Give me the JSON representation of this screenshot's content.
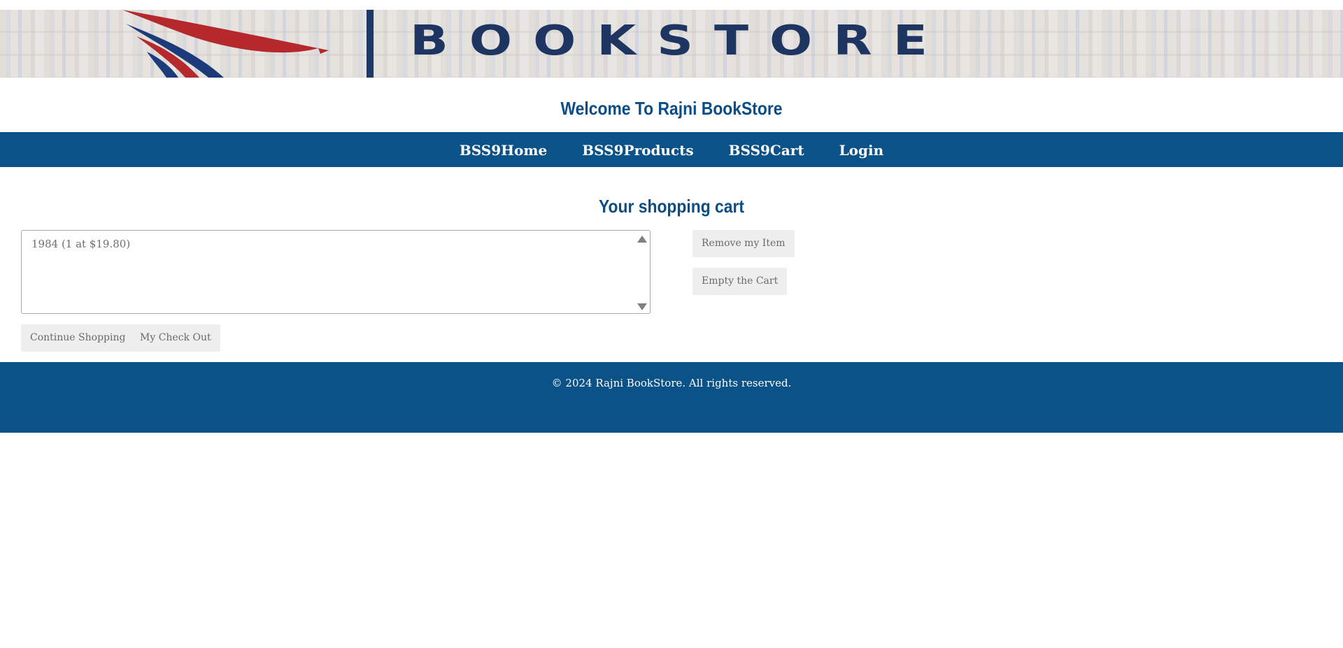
{
  "banner": {
    "brand": "BOOKSTORE",
    "logo_icon": "eagle-wing-logo-icon",
    "colors": {
      "brand_navy": "#1e3561",
      "wing_red": "#b5282c",
      "wing_blue": "#1d3a7a"
    }
  },
  "header": {
    "welcome": "Welcome To Rajni BookStore"
  },
  "nav": {
    "items": [
      {
        "label": "BSS9Home"
      },
      {
        "label": "BSS9Products"
      },
      {
        "label": "BSS9Cart"
      },
      {
        "label": "Login"
      }
    ],
    "background": "#0b5288"
  },
  "cart": {
    "title": "Your shopping cart",
    "items": [
      {
        "label": "1984 (1 at $19.80)"
      }
    ],
    "buttons": {
      "remove": "Remove my Item",
      "empty": "Empty the Cart",
      "continue": "Continue Shopping",
      "checkout": "My Check Out"
    }
  },
  "footer": {
    "text": "© 2024 Rajni BookStore. All rights reserved.",
    "background": "#0b5288"
  },
  "colors": {
    "accent_blue": "#0b4d86",
    "button_bg": "#eeeeee"
  }
}
